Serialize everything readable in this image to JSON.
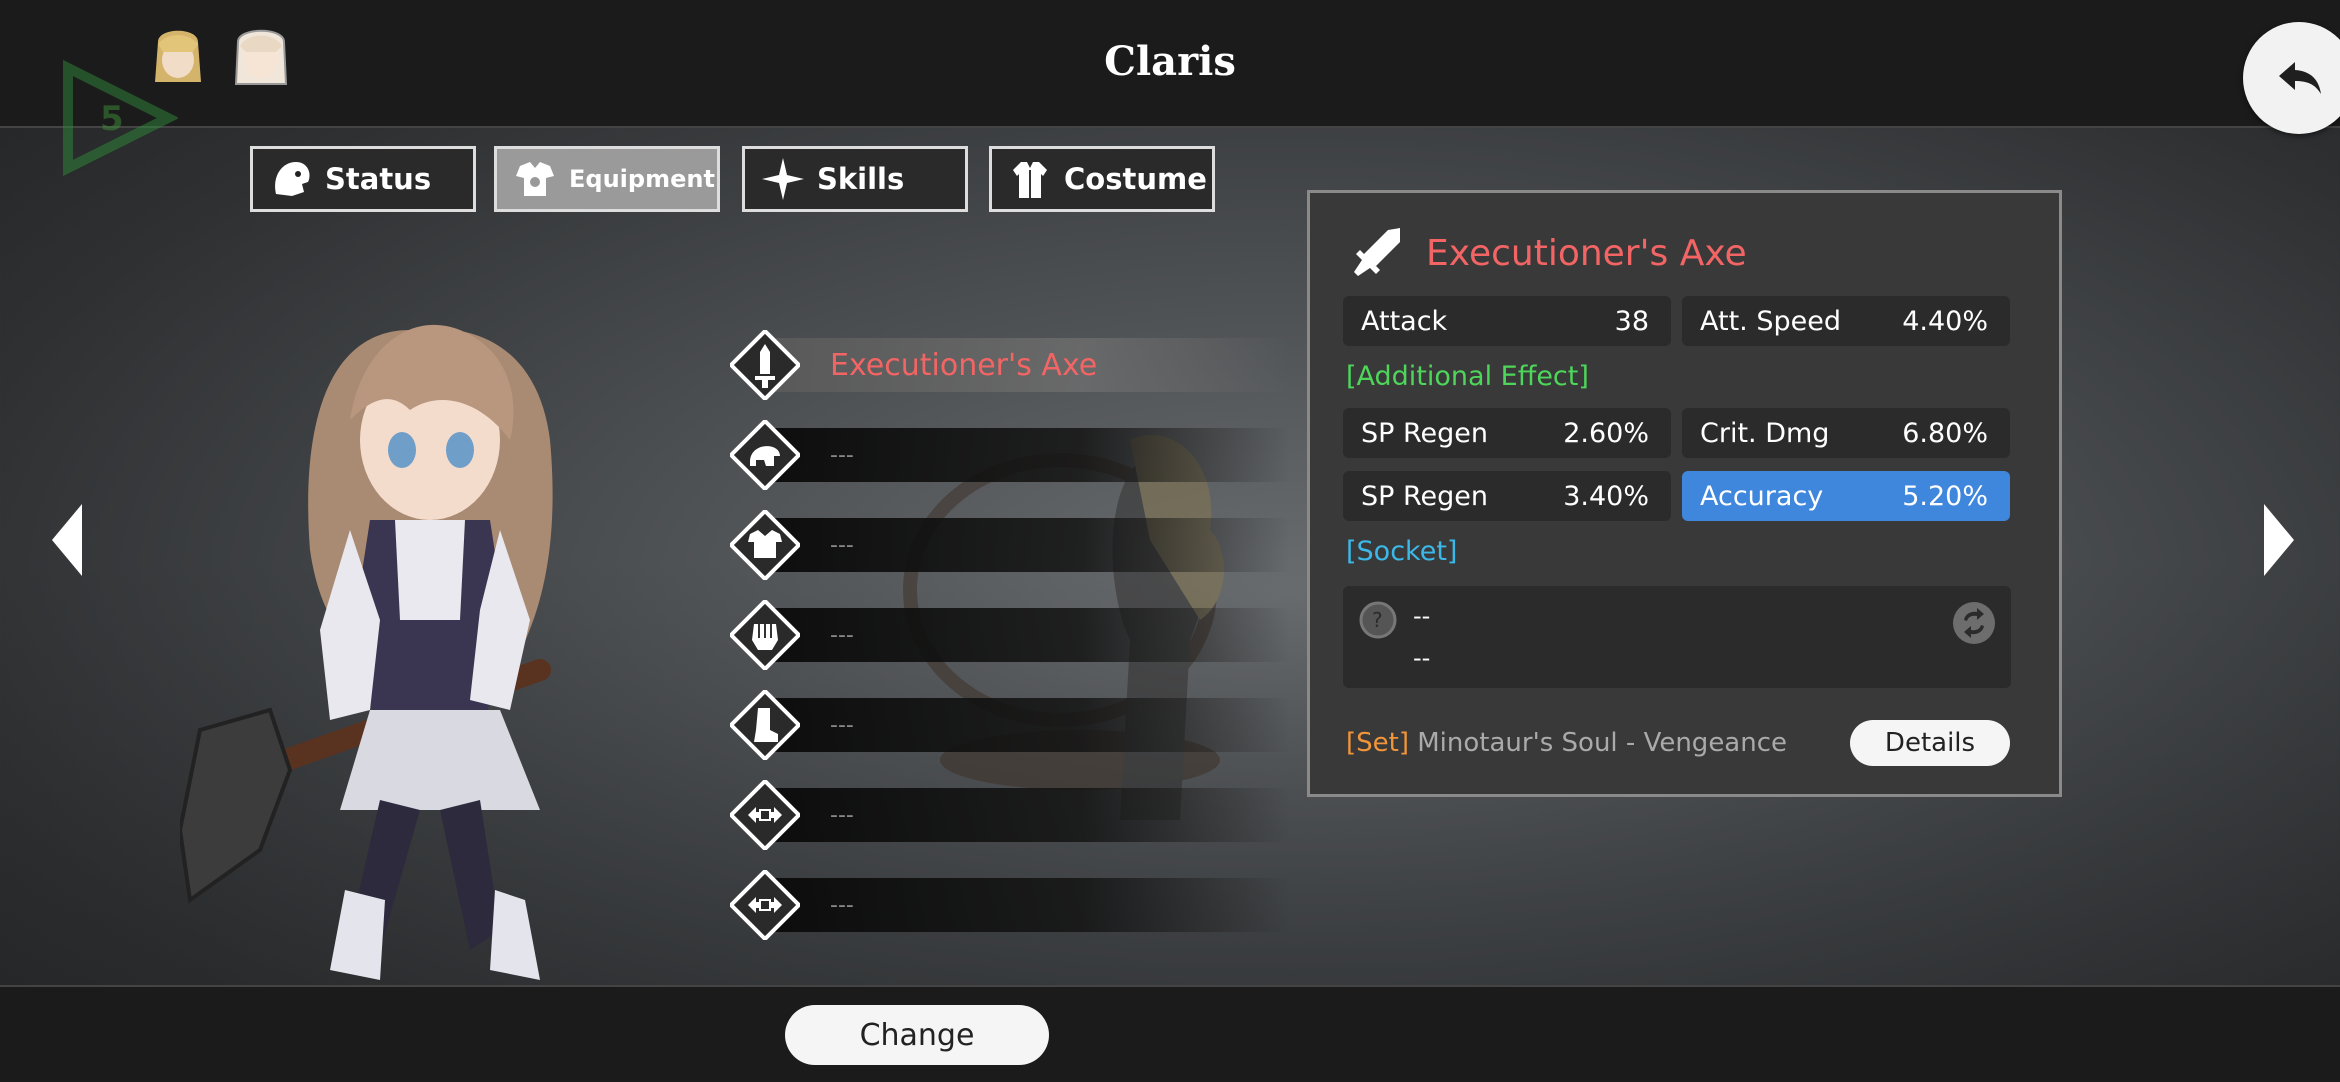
{
  "header": {
    "title": "Claris",
    "level_badge": "5"
  },
  "tabs": [
    {
      "label": "Status",
      "icon": "lion-head-icon",
      "active": false
    },
    {
      "label": "Equipment",
      "icon": "armor-icon",
      "active": true
    },
    {
      "label": "Skills",
      "icon": "sparkle-icon",
      "active": false
    },
    {
      "label": "Costume",
      "icon": "shirt-icon",
      "active": false
    }
  ],
  "slots": [
    {
      "name": "Executioner's Axe",
      "icon": "sword-icon",
      "selected": true
    },
    {
      "name": "---",
      "icon": "helmet-icon"
    },
    {
      "name": "---",
      "icon": "armor-icon"
    },
    {
      "name": "---",
      "icon": "gauntlet-icon"
    },
    {
      "name": "---",
      "icon": "boot-icon"
    },
    {
      "name": "---",
      "icon": "accessory-icon"
    },
    {
      "name": "---",
      "icon": "accessory-icon"
    }
  ],
  "detail": {
    "item_name": "Executioner's Axe",
    "stats": [
      {
        "label": "Attack",
        "value": "38"
      },
      {
        "label": "Att. Speed",
        "value": "4.40%"
      }
    ],
    "additional_effect_title": "[Additional Effect]",
    "effects": [
      {
        "label": "SP Regen",
        "value": "2.60%"
      },
      {
        "label": "Crit. Dmg",
        "value": "6.80%"
      },
      {
        "label": "SP Regen",
        "value": "3.40%"
      },
      {
        "label": "Accuracy",
        "value": "5.20%",
        "highlighted": true
      }
    ],
    "socket_title": "[Socket]",
    "socket_line1": "--",
    "socket_line2": "--",
    "set_tag": "[Set]",
    "set_name": "Minotaur's Soul - Vengeance",
    "details_label": "Details"
  },
  "footer": {
    "change_label": "Change"
  },
  "colors": {
    "item_name": "#f36565",
    "additional_effect": "#4dd65a",
    "socket": "#3cb8e8",
    "set_tag": "#f0953a",
    "highlight": "#3f86dd"
  }
}
